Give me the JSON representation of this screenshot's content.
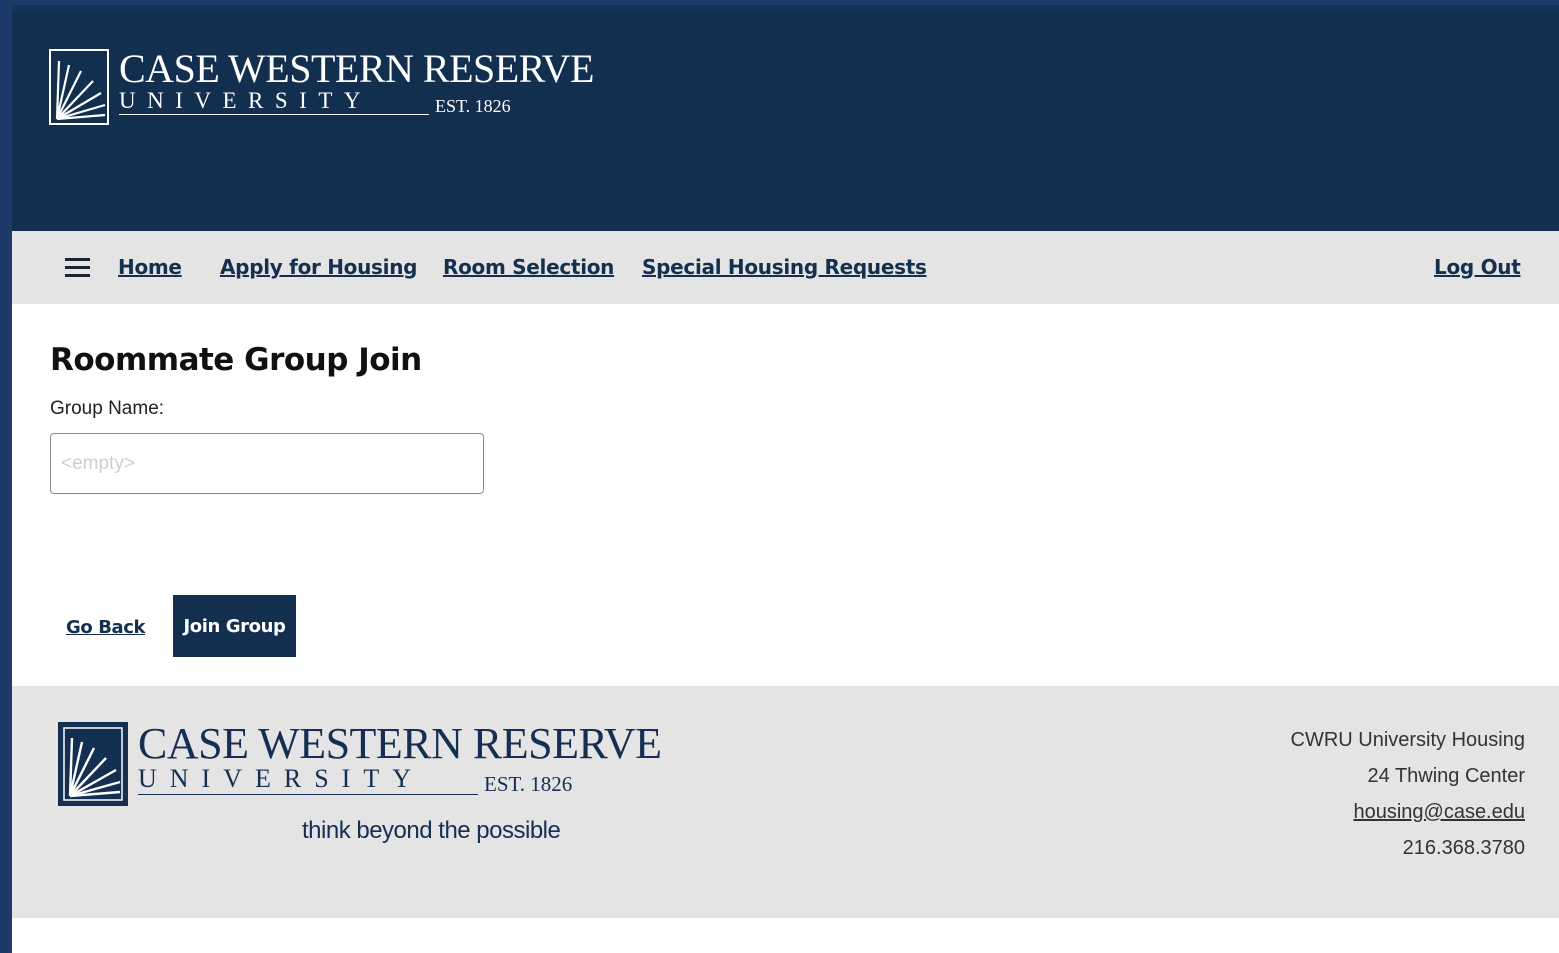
{
  "header": {
    "logo": {
      "name": "CASE WESTERN RESERVE",
      "university": "UNIVERSITY",
      "est": "EST. 1826"
    }
  },
  "nav": {
    "menu_icon": "hamburger-menu-icon",
    "items": [
      {
        "label": "Home"
      },
      {
        "label": "Apply for Housing"
      },
      {
        "label": "Room Selection"
      },
      {
        "label": "Special Housing Requests"
      }
    ],
    "logout_label": "Log Out"
  },
  "main": {
    "title": "Roommate Group Join",
    "group_name_label": "Group Name:",
    "group_name_value": "",
    "group_name_placeholder": "<empty>",
    "go_back_label": "Go Back",
    "join_label": "Join Group"
  },
  "footer": {
    "logo": {
      "name": "CASE WESTERN RESERVE",
      "university": "UNIVERSITY",
      "est": "EST. 1826",
      "tagline": "think beyond the possible"
    },
    "contact": {
      "org": "CWRU University Housing",
      "address": "24 Thwing Center",
      "email": "housing@case.edu",
      "phone": "216.368.3780"
    }
  },
  "colors": {
    "brand_navy": "#132f50",
    "nav_bg": "#e4e4e4",
    "outer_border": "#1d3a6b"
  }
}
